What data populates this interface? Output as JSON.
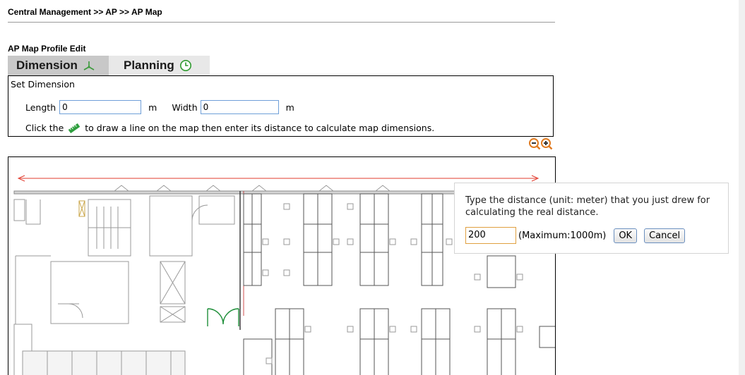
{
  "breadcrumb": "Central Management >> AP >> AP Map",
  "section_title": "AP Map Profile Edit",
  "tabs": [
    {
      "label": "Dimension",
      "icon": "ruler-axes-icon",
      "active": true
    },
    {
      "label": "Planning",
      "icon": "clock-icon",
      "active": false
    }
  ],
  "dimension": {
    "title": "Set Dimension",
    "length_label": "Length",
    "length_value": "0",
    "width_label": "Width",
    "width_value": "0",
    "unit": "m",
    "instruction_prefix": "Click the",
    "instruction_suffix": "to draw a line on the map then enter its distance to calculate map dimensions."
  },
  "zoom": {
    "out_icon": "zoom-out-icon",
    "in_icon": "zoom-in-icon"
  },
  "dialog": {
    "message": "Type the distance (unit: meter) that you just drew for calculating the real distance.",
    "value": "200",
    "max_text": "(Maximum:1000m)",
    "ok_label": "OK",
    "cancel_label": "Cancel"
  },
  "colors": {
    "measure_line": "#e23b2e",
    "input_border": "#6f9fd8",
    "door": "#1f8f3a",
    "tab_active": "#c8c8c8",
    "tab_inactive": "#e8e8e8"
  }
}
